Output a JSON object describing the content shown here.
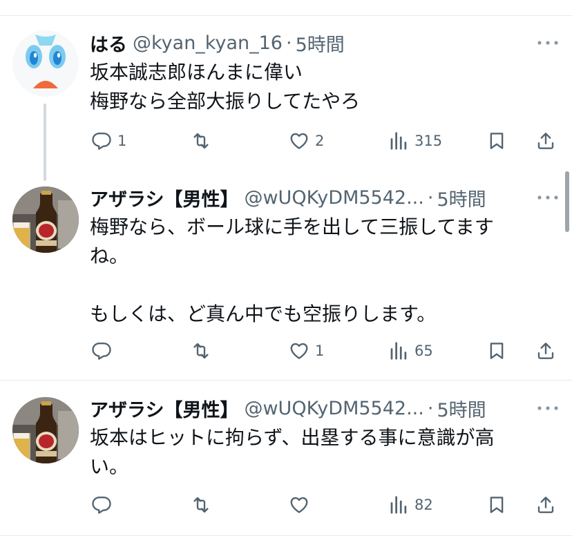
{
  "tweets": [
    {
      "name": "はる",
      "handle": "@kyan_kyan_16",
      "sep": "·",
      "time": "5時間",
      "text": "坂本誠志郎ほんまに偉い\n梅野なら全部大振りしてたやろ",
      "replies": "1",
      "retweets": "",
      "likes": "2",
      "views": "315",
      "avatar": "round-creature-avatar"
    },
    {
      "name": "アザラシ【男性】",
      "handle": "@wUQKyDM5542...",
      "sep": "·",
      "time": "5時間",
      "text": "梅野なら、ボール球に手を出して三振してます\nね。\n\nもしくは、ど真ん中でも空振りします。",
      "replies": "",
      "retweets": "",
      "likes": "1",
      "views": "65",
      "avatar": "beer-bottle-avatar"
    },
    {
      "name": "アザラシ【男性】",
      "handle": "@wUQKyDM5542...",
      "sep": "·",
      "time": "5時間",
      "text": "坂本はヒットに拘らず、出塁する事に意識が高\nい。",
      "replies": "",
      "retweets": "",
      "likes": "",
      "views": "82",
      "avatar": "beer-bottle-avatar"
    }
  ],
  "colors": {
    "text": "#0f1419",
    "secondary": "#536471",
    "divider": "#e6e9ec",
    "thread_line": "#cfd9de"
  },
  "icons": [
    "reply-icon",
    "retweet-icon",
    "like-icon",
    "views-icon",
    "bookmark-icon",
    "share-icon",
    "more-icon"
  ]
}
